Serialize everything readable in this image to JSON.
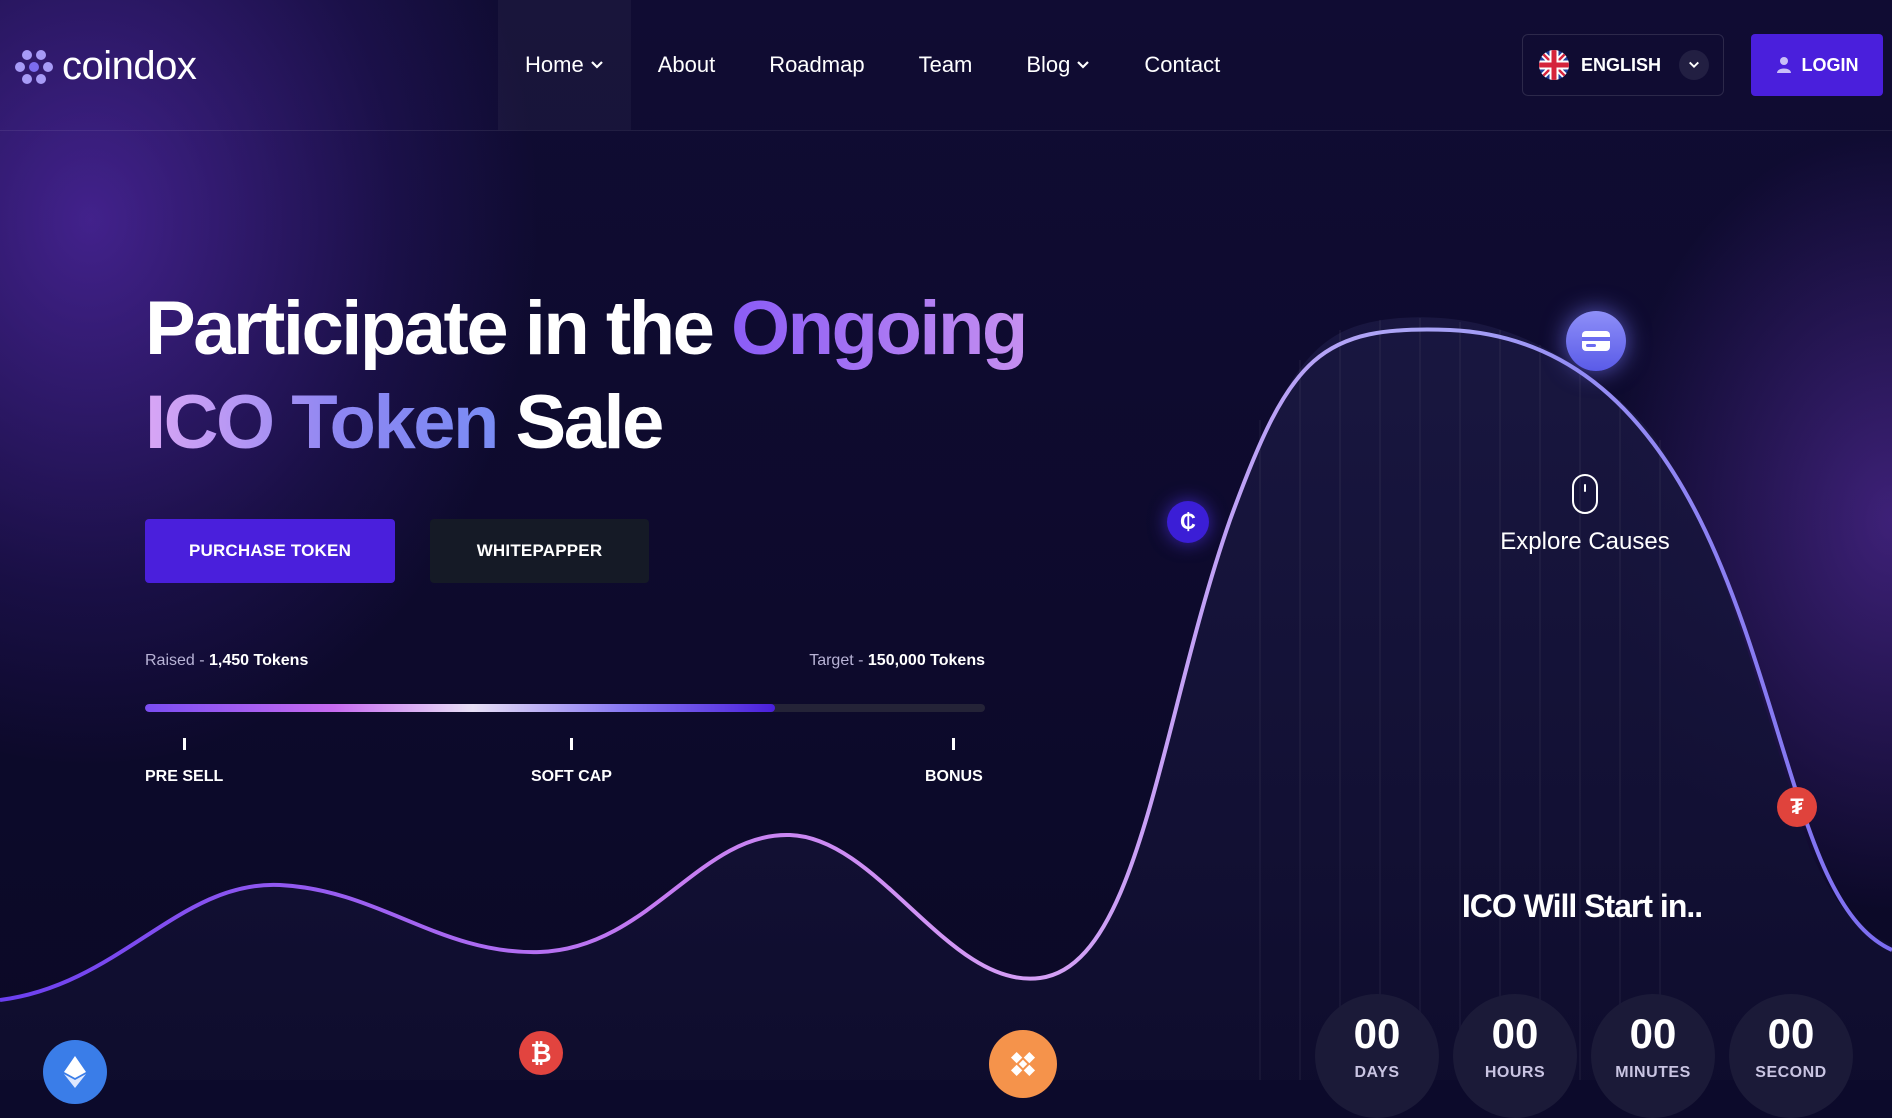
{
  "header": {
    "logo_text": "coindox",
    "nav": [
      {
        "label": "Home",
        "has_dropdown": true,
        "active": true
      },
      {
        "label": "About",
        "has_dropdown": false
      },
      {
        "label": "Roadmap",
        "has_dropdown": false
      },
      {
        "label": "Team",
        "has_dropdown": false
      },
      {
        "label": "Blog",
        "has_dropdown": true
      },
      {
        "label": "Contact",
        "has_dropdown": false
      }
    ],
    "language": "ENGLISH",
    "login_label": "LOGIN"
  },
  "hero": {
    "title_parts": {
      "part1": "Participate in the ",
      "part2": "Ongoing",
      "part3": "ICO Token",
      "part4": " Sale"
    },
    "primary_button": "PURCHASE TOKEN",
    "secondary_button": "WHITEPAPPER"
  },
  "progress": {
    "raised_label": "Raised - ",
    "raised_value": "1,450 Tokens",
    "target_label": "Target - ",
    "target_value": "150,000 Tokens",
    "fill_percent": 75,
    "milestones": [
      "PRE SELL",
      "SOFT CAP",
      "BONUS"
    ]
  },
  "explore": {
    "label": "Explore Causes"
  },
  "countdown": {
    "title": "ICO Will Start in..",
    "units": [
      {
        "value": "00",
        "label": "DAYS"
      },
      {
        "value": "00",
        "label": "HOURS"
      },
      {
        "value": "00",
        "label": "MINUTES"
      },
      {
        "value": "00",
        "label": "SECOND"
      }
    ]
  },
  "icons": {
    "logo": "hexagon-cluster-icon",
    "flag": "uk-flag-icon",
    "user": "user-icon",
    "coins": [
      "ethereum-icon",
      "bitcoin-icon",
      "binance-icon",
      "celo-icon",
      "card-icon",
      "tether-icon"
    ]
  },
  "colors": {
    "brand": "#4a1fdc",
    "background": "#0c0a2b",
    "accent_gradient_start": "#8a5cf6",
    "accent_gradient_end": "#c58ff0"
  }
}
